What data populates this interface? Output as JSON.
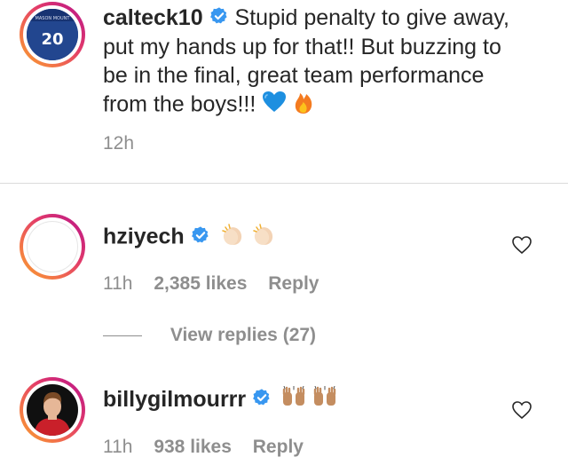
{
  "post": {
    "username": "calteck10",
    "text_line1": "Stupid penalty to give away,",
    "text_line2": "put my hands up for that!! But buzzing to",
    "text_line3": "be in the final, great team performance",
    "text_line4": "from the boys!!!",
    "emojis": [
      "blue-heart-emoji",
      "fire-emoji"
    ],
    "jersey_number": "20",
    "time": "12h"
  },
  "comments": [
    {
      "username": "hziyech",
      "emojis": [
        "clapping-hands-emoji",
        "clapping-hands-emoji"
      ],
      "time": "11h",
      "likes": "2,385 likes",
      "reply": "Reply",
      "view_replies": "View replies (27)"
    },
    {
      "username": "billygilmourrr",
      "emojis": [
        "raising-hands-emoji",
        "raising-hands-emoji"
      ],
      "time": "11h",
      "likes": "938 likes",
      "reply": "Reply"
    }
  ],
  "colors": {
    "text": "#262626",
    "secondary": "#8e8e8e",
    "verified": "#3897f0",
    "ring_start": "#f9a12e",
    "ring_end": "#b1237f"
  }
}
